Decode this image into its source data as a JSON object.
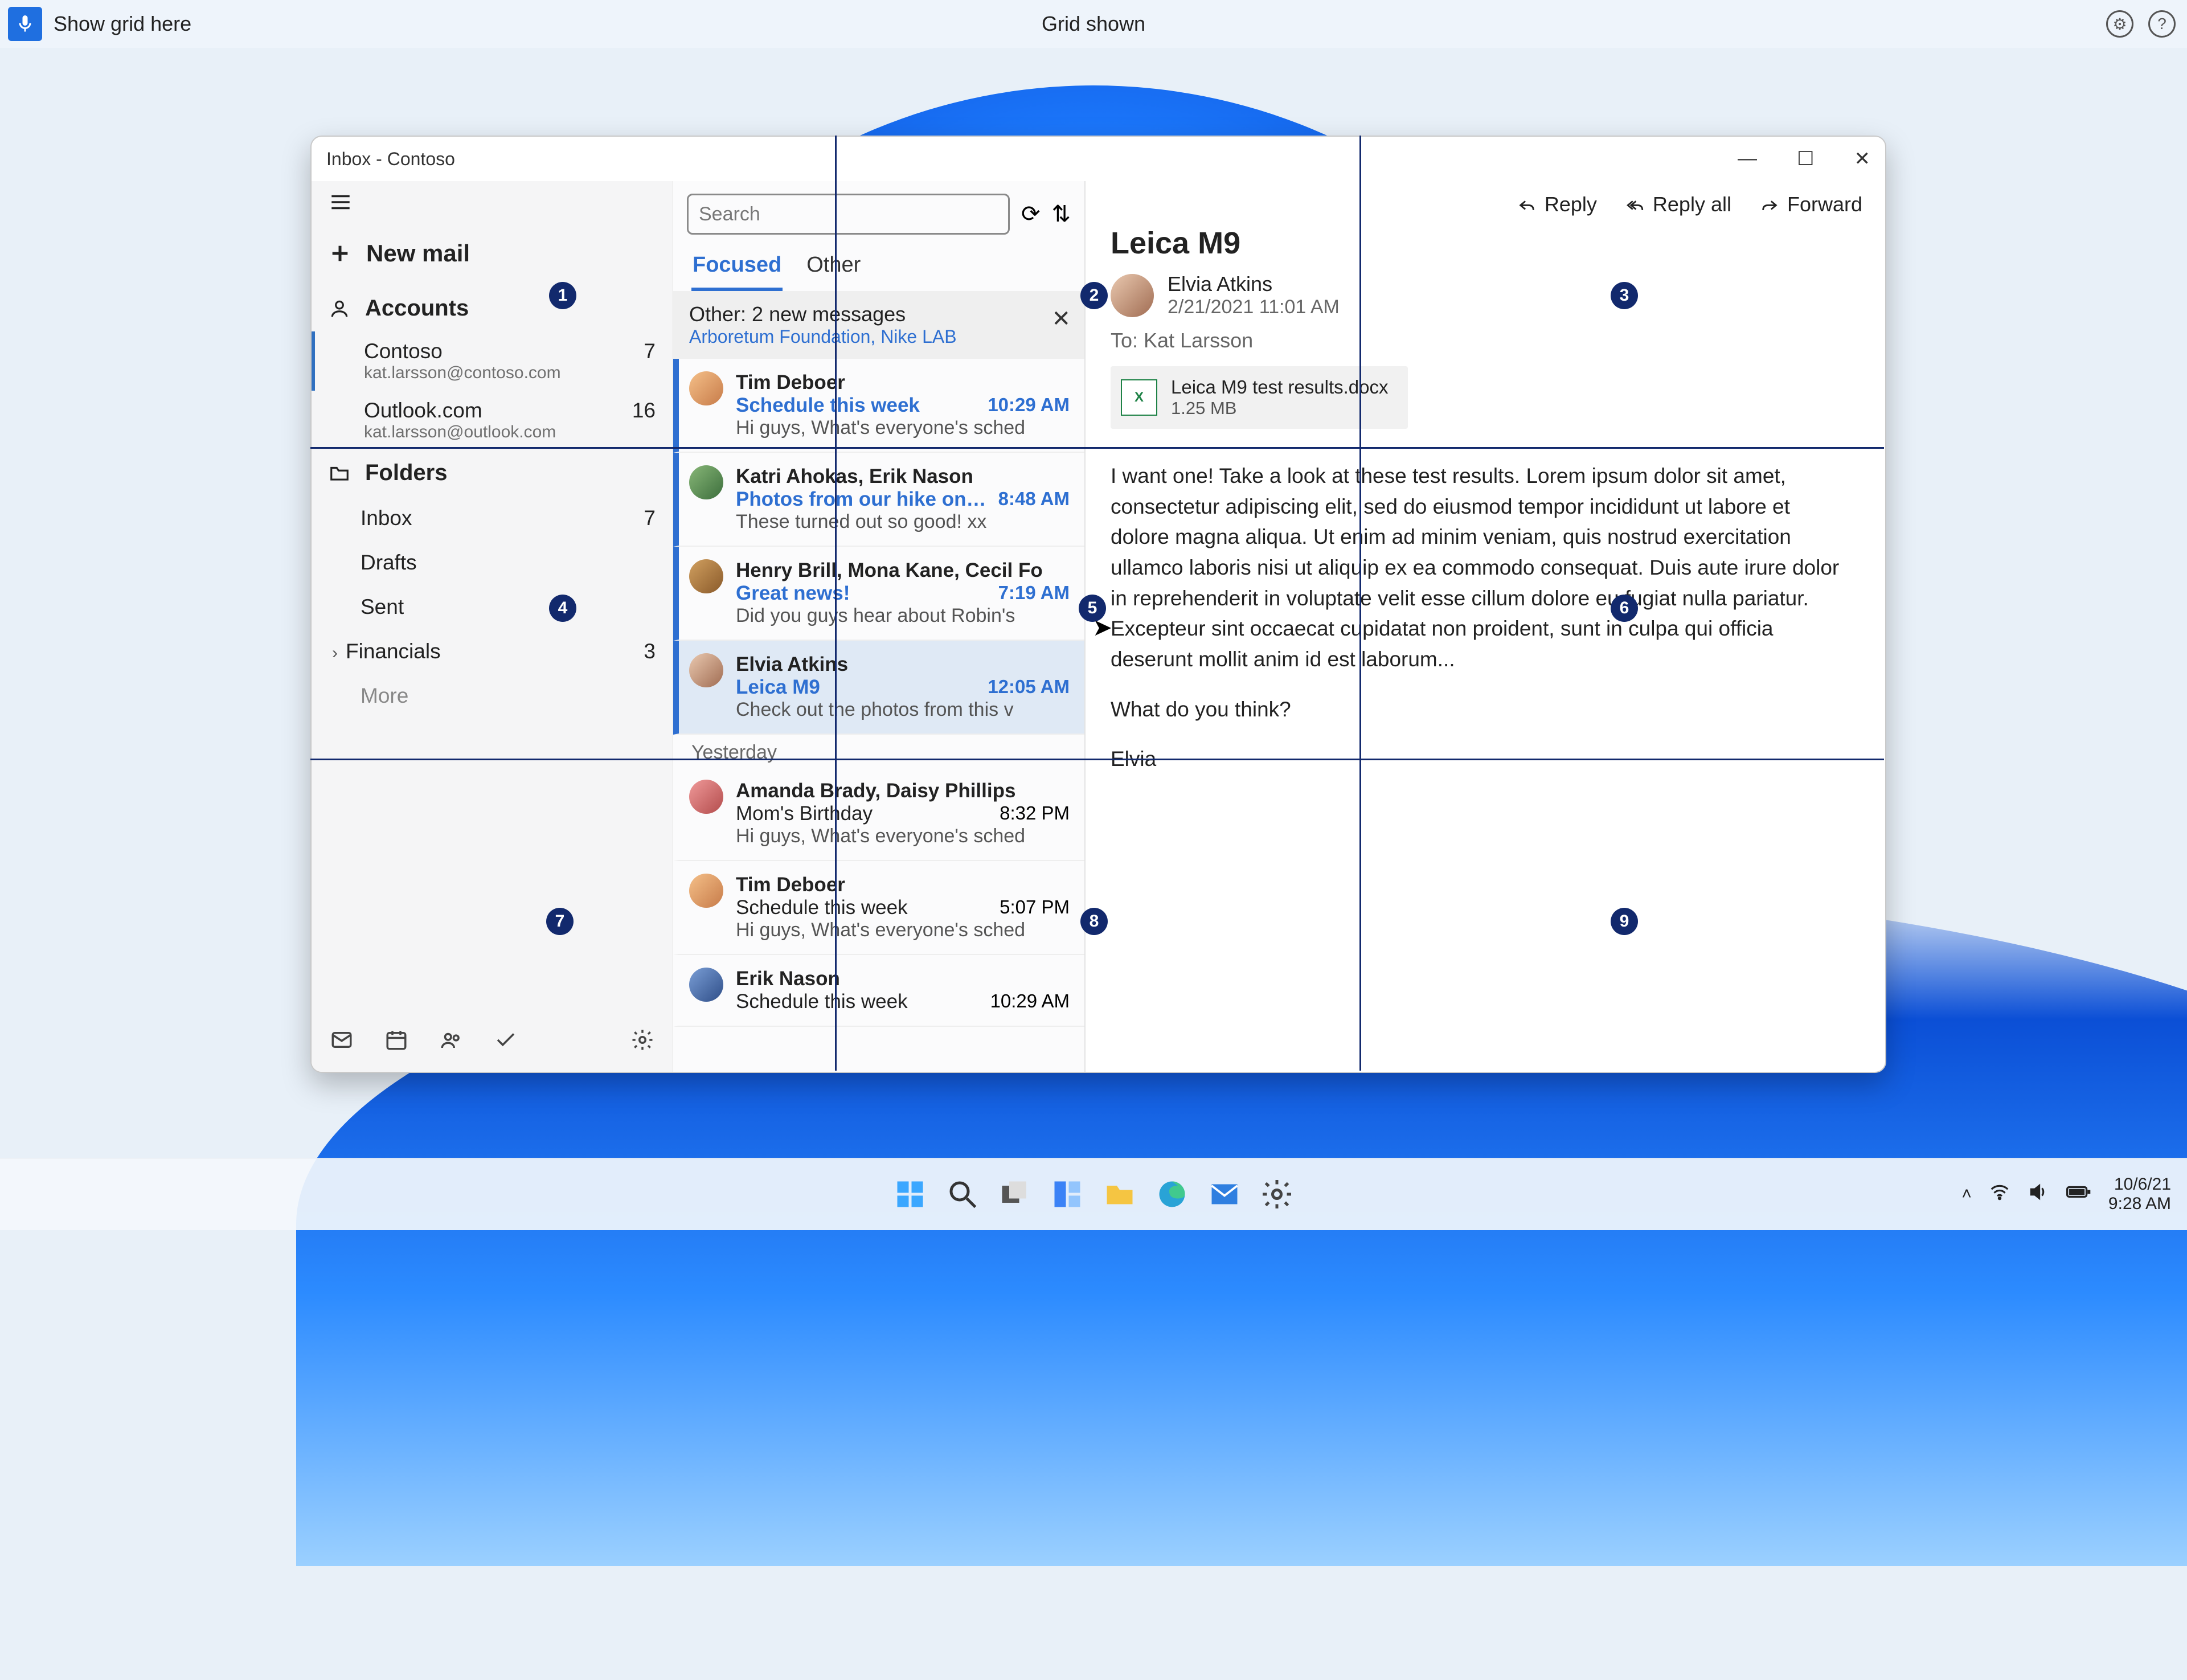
{
  "voicebar": {
    "left": "Show grid here",
    "center": "Grid shown"
  },
  "window": {
    "title": "Inbox - Contoso",
    "nav": {
      "newmail": "New mail",
      "accounts_label": "Accounts",
      "accounts": [
        {
          "name": "Contoso",
          "email": "kat.larsson@contoso.com",
          "count": "7"
        },
        {
          "name": "Outlook.com",
          "email": "kat.larsson@outlook.com",
          "count": "16"
        }
      ],
      "folders_label": "Folders",
      "folders": [
        {
          "name": "Inbox",
          "count": "7"
        },
        {
          "name": "Drafts",
          "count": ""
        },
        {
          "name": "Sent",
          "count": ""
        },
        {
          "name": "Financials",
          "count": "3",
          "chev": true
        }
      ],
      "more": "More"
    },
    "list": {
      "search_placeholder": "Search",
      "tabs": {
        "focused": "Focused",
        "other": "Other"
      },
      "other_banner": {
        "line1": "Other: 2 new messages",
        "line2": "Arboretum Foundation, Nike LAB"
      },
      "messages": [
        {
          "sender": "Tim Deboer",
          "subject": "Schedule this week",
          "time": "10:29 AM",
          "preview": "Hi guys, What's everyone's sched",
          "unread": true,
          "av": "av-a"
        },
        {
          "sender": "Katri Ahokas, Erik Nason",
          "subject": "Photos from our hike on Maple",
          "time": "8:48 AM",
          "preview": "These turned out so good! xx",
          "unread": true,
          "av": "av-b"
        },
        {
          "sender": "Henry Brill, Mona Kane, Cecil Fo",
          "subject": "Great news!",
          "time": "7:19 AM",
          "preview": "Did you guys hear about Robin's",
          "unread": true,
          "av": "av-c"
        },
        {
          "sender": "Elvia Atkins",
          "subject": "Leica M9",
          "time": "12:05 AM",
          "preview": "Check out the photos from this v",
          "unread": true,
          "sel": true,
          "av": "av-d"
        }
      ],
      "day_header": "Yesterday",
      "messages2": [
        {
          "sender": "Amanda Brady, Daisy Phillips",
          "subject": "Mom's Birthday",
          "time": "8:32 PM",
          "preview": "Hi guys, What's everyone's sched",
          "av": "av-e"
        },
        {
          "sender": "Tim Deboer",
          "subject": "Schedule this week",
          "time": "5:07 PM",
          "preview": "Hi guys, What's everyone's sched",
          "av": "av-a"
        },
        {
          "sender": "Erik Nason",
          "subject": "Schedule this week",
          "time": "10:29 AM",
          "preview": "",
          "av": "av-f"
        }
      ]
    },
    "read": {
      "actions": {
        "reply": "Reply",
        "replyall": "Reply all",
        "forward": "Forward"
      },
      "subject": "Leica M9",
      "from": "Elvia Atkins",
      "date": "2/21/2021 11:01 AM",
      "to_label": "To:",
      "to": "Kat Larsson",
      "attachment": {
        "name": "Leica M9 test results.docx",
        "size": "1.25 MB"
      },
      "body_p1": "I want one! Take a look at these test results. Lorem ipsum dolor sit amet, consectetur adipiscing elit, sed do eiusmod tempor incididunt ut labore et dolore magna aliqua. Ut enim ad minim veniam, quis nostrud exercitation ullamco laboris nisi ut aliquip ex ea commodo consequat. Duis aute irure dolor in reprehenderit in voluptate velit esse cillum dolore eu fugiat nulla pariatur. Excepteur sint occaecat cupidatat non proident, sunt in culpa qui officia deserunt mollit anim id est laborum...",
      "body_p2": "What do you think?",
      "body_p3": "Elvia"
    }
  },
  "grid": {
    "numbers": [
      "1",
      "2",
      "3",
      "4",
      "5",
      "6",
      "7",
      "8",
      "9"
    ]
  },
  "taskbar": {
    "date": "10/6/21",
    "time": "9:28 AM"
  }
}
